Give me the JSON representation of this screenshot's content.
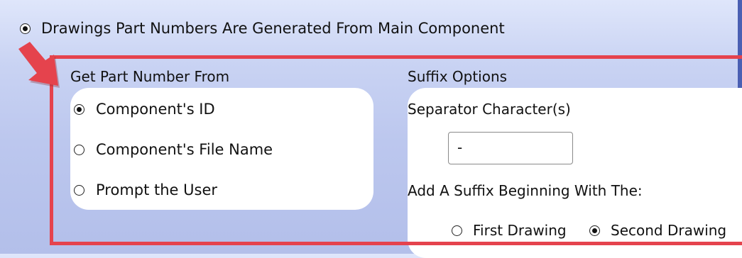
{
  "top_option": {
    "label": "Drawings Part Numbers Are Generated From Main Component",
    "selected": true
  },
  "part_number_group": {
    "title": "Get Part Number From",
    "options": [
      {
        "label": "Component's ID",
        "selected": true
      },
      {
        "label": "Component's File Name",
        "selected": false
      },
      {
        "label": "Prompt the User",
        "selected": false
      }
    ]
  },
  "suffix_group": {
    "title": "Suffix Options",
    "separator_label": "Separator Character(s)",
    "separator_value": "-",
    "suffix_begin_label": "Add A Suffix Beginning With The:",
    "options": [
      {
        "label": "First Drawing",
        "selected": false
      },
      {
        "label": "Second Drawing",
        "selected": true
      }
    ]
  },
  "colors": {
    "highlight": "#e5434d",
    "accent_edge": "#4a5fb3"
  }
}
